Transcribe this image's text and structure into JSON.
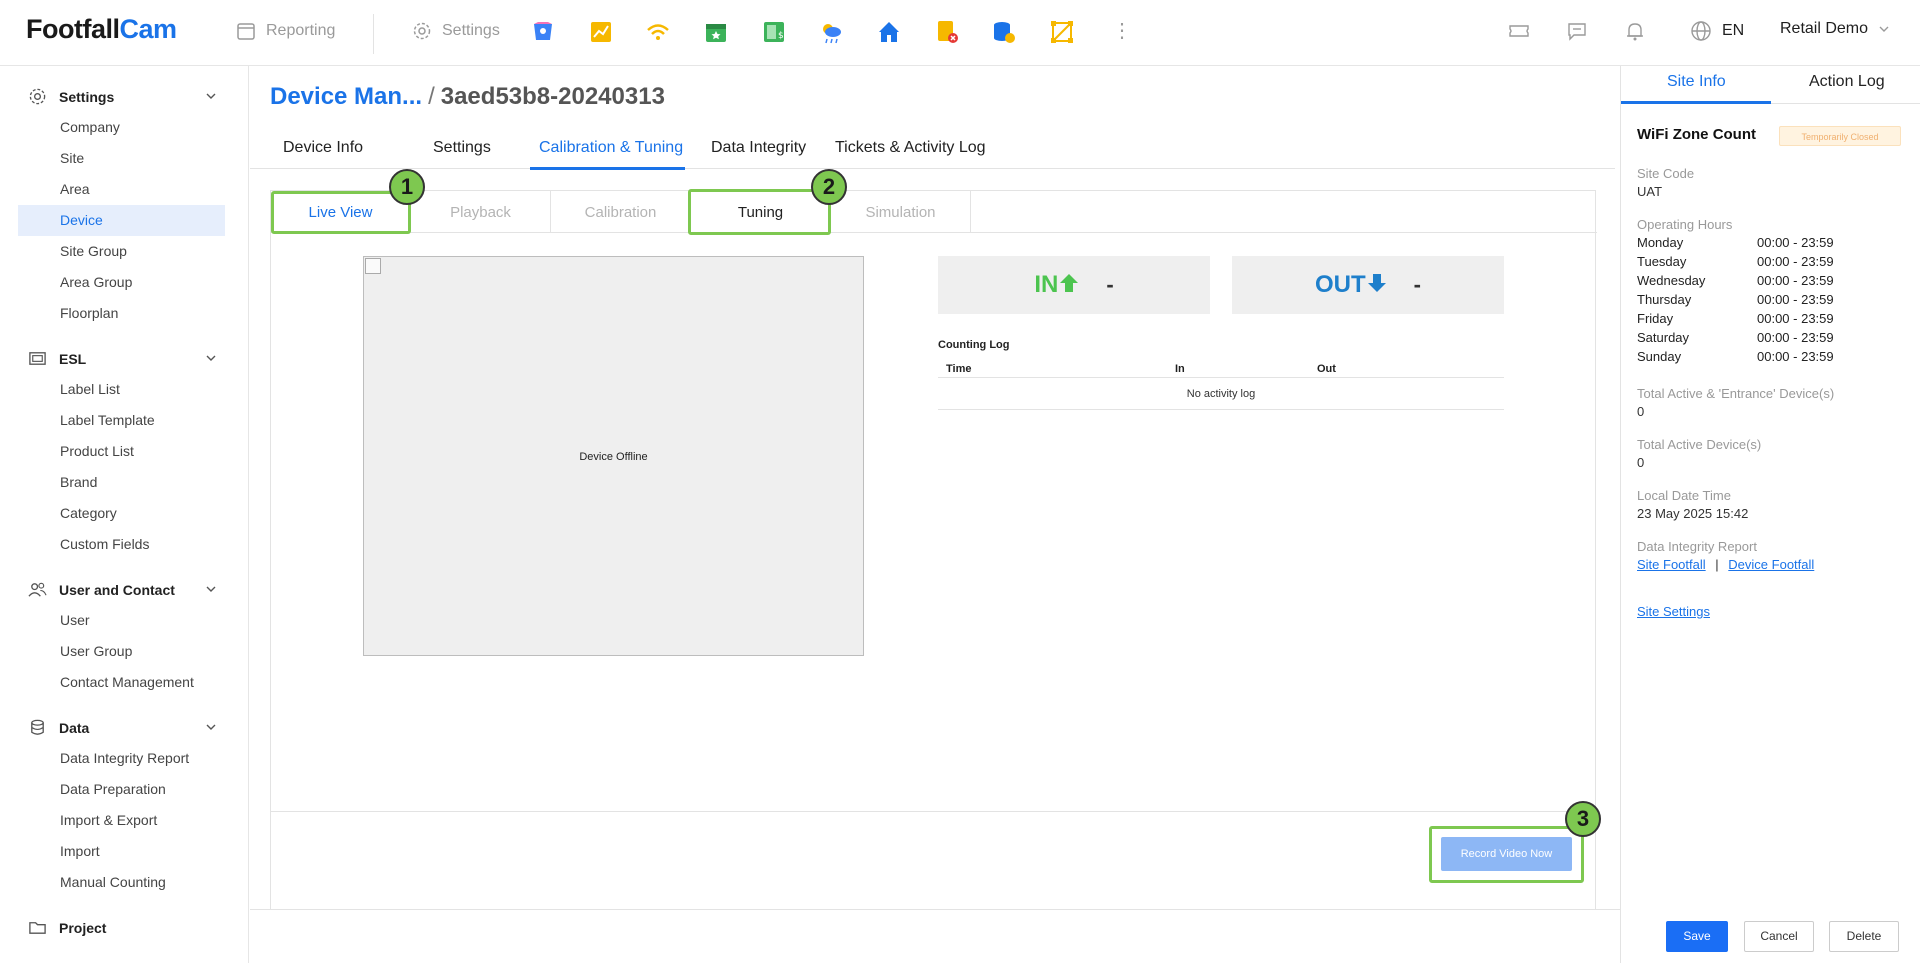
{
  "header": {
    "logo_a": "Footfall",
    "logo_b": "Cam",
    "reporting_label": "Reporting",
    "settings_label": "Settings",
    "app_icons": [
      "people-counter-icon",
      "chart-icon",
      "wifi-icon",
      "calendar-icon",
      "sales-icon",
      "weather-icon",
      "home-icon",
      "alert-document-icon",
      "database-icon",
      "transform-icon"
    ],
    "lang": "EN",
    "user": "Retail Demo"
  },
  "sidebar": {
    "groups": [
      {
        "label": "Settings",
        "items": [
          "Company",
          "Site",
          "Area",
          "Device",
          "Site Group",
          "Area Group",
          "Floorplan"
        ]
      },
      {
        "label": "ESL",
        "items": [
          "Label List",
          "Label Template",
          "Product List",
          "Brand",
          "Category",
          "Custom Fields"
        ]
      },
      {
        "label": "User and Contact",
        "items": [
          "User",
          "User Group",
          "Contact Management"
        ]
      },
      {
        "label": "Data",
        "items": [
          "Data Integrity Report",
          "Data Preparation",
          "Import & Export",
          "Import",
          "Manual Counting"
        ]
      },
      {
        "label": "Project",
        "items": []
      }
    ],
    "active_item": "Device"
  },
  "main": {
    "breadcrumb_1": "Device Man...",
    "breadcrumb_sep": "/",
    "breadcrumb_2": "3aed53b8-20240313",
    "tabs": [
      "Device Info",
      "Settings",
      "Calibration & Tuning",
      "Data Integrity",
      "Tickets & Activity Log"
    ],
    "subtabs": [
      "Live View",
      "Playback",
      "Calibration",
      "Tuning",
      "Simulation"
    ],
    "badges": [
      "1",
      "2",
      "3"
    ],
    "video_message": "Device Offline",
    "in_label": "IN",
    "in_value": "-",
    "out_label": "OUT",
    "out_value": "-",
    "log_title": "Counting Log",
    "log_headers": [
      "Time",
      "In",
      "Out"
    ],
    "log_empty": "No activity log",
    "record_button": "Record Video Now"
  },
  "right_panel": {
    "tabs": [
      "Site Info",
      "Action Log"
    ],
    "title": "WiFi Zone Count",
    "status": "Temporarily Closed",
    "site_code_label": "Site Code",
    "site_code": "UAT",
    "hours_label": "Operating Hours",
    "hours": [
      {
        "day": "Monday",
        "time": "00:00 - 23:59"
      },
      {
        "day": "Tuesday",
        "time": "00:00 - 23:59"
      },
      {
        "day": "Wednesday",
        "time": "00:00 - 23:59"
      },
      {
        "day": "Thursday",
        "time": "00:00 - 23:59"
      },
      {
        "day": "Friday",
        "time": "00:00 - 23:59"
      },
      {
        "day": "Saturday",
        "time": "00:00 - 23:59"
      },
      {
        "day": "Sunday",
        "time": "00:00 - 23:59"
      }
    ],
    "total_entrance_label": "Total Active & 'Entrance' Device(s)",
    "total_entrance": "0",
    "total_active_label": "Total Active Device(s)",
    "total_active": "0",
    "local_time_label": "Local Date Time",
    "local_time": "23 May 2025 15:42",
    "dir_label": "Data Integrity Report",
    "link_site_footfall": "Site Footfall",
    "link_sep": "|",
    "link_device_footfall": "Device Footfall",
    "site_settings": "Site Settings"
  },
  "footer": {
    "save": "Save",
    "cancel": "Cancel",
    "delete": "Delete"
  },
  "colors": {
    "accent": "#1a73e8",
    "highlight": "#7ec850",
    "in": "#4cc44f",
    "out": "#1e7fcb"
  }
}
